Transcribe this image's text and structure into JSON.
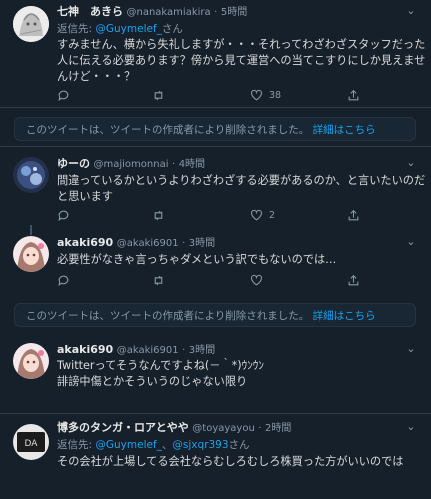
{
  "tweets": [
    {
      "display_name": "七神　あきら",
      "handle": "@nanakamiakira",
      "time": "5時間",
      "reply_prefix": "返信先:",
      "reply_to": "@Guymelef_",
      "reply_suffix": "さん",
      "lines": [
        "すみません、横から失礼しますが・・・それってわざわざスタッフだった",
        "人に伝える必要あります？傍から見て運営への当てこすりにしか見えませ",
        "んけど・・・？"
      ],
      "counts": {
        "replies": "",
        "retweets": "",
        "likes": "38"
      }
    },
    {
      "display_name": "ゆーの",
      "handle": "@majiomonnai",
      "time": "4時間",
      "lines": [
        "間違っているかというよりわざわざする必要があるのか、と言いたいのだ",
        "と思います"
      ],
      "counts": {
        "replies": "",
        "retweets": "",
        "likes": "2"
      }
    },
    {
      "display_name": "akaki690",
      "handle": "@akaki6901",
      "time": "3時間",
      "lines": [
        "必要性がなきゃ言っちゃダメという訳でもないのでは…"
      ],
      "counts": {
        "replies": "",
        "retweets": "",
        "likes": ""
      }
    },
    {
      "display_name": "akaki690",
      "handle": "@akaki6901",
      "time": "3時間",
      "lines": [
        "Twitterってそうなんですよね(－｀*)ｳﾝｳﾝ",
        "誹謗中傷とかそういうのじゃない限り"
      ],
      "counts": {
        "replies": "",
        "retweets": "",
        "likes": ""
      }
    },
    {
      "display_name": "博多のタンガ・ロアとやや",
      "handle": "@toyayayou",
      "time": "2時間",
      "reply_prefix": "返信先:",
      "reply_to": "@Guymelef_",
      "reply_mid": "、",
      "reply_to2": "@sjxqr393",
      "reply_suffix": "さん",
      "lines": [
        "その会社が上場してる会社ならむしろむしろ株買った方がいいのでは"
      ],
      "counts": {}
    }
  ],
  "deleted_notice": {
    "message": "このツイートは、ツイートの作成者により削除されました。",
    "learn_more": "詳細はこちら"
  },
  "icons": {
    "reply": "reply-icon",
    "retweet": "retweet-icon",
    "like": "heart-icon",
    "share": "share-icon",
    "more": "caret-down-icon"
  },
  "colors": {
    "background": "#15202b",
    "link": "#1da1f2",
    "muted": "#8899a6"
  }
}
